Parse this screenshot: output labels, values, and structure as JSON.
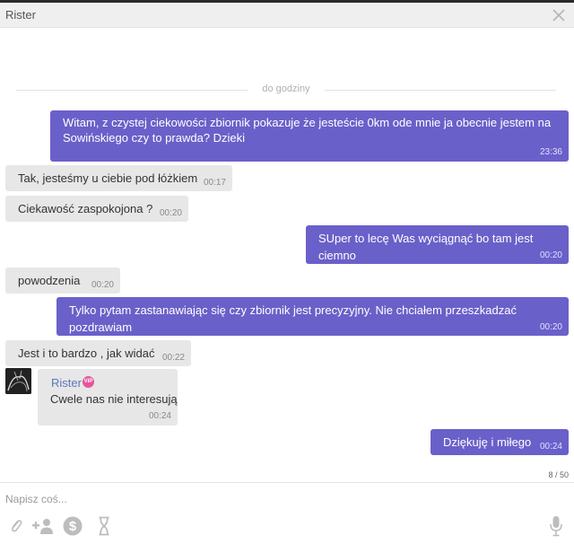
{
  "window": {
    "title": "Rister"
  },
  "divider": {
    "label": "do godziny"
  },
  "messages": [
    {
      "direction": "out",
      "text_lines": [
        "Witam, z czystej ciekowości zbiornik pokazuje że jesteście 0km ode mnie ja obecnie jestem na",
        "Sowińskiego czy to prawda? Dzieki"
      ],
      "time": "23:36"
    },
    {
      "direction": "in",
      "text": "Tak, jesteśmy u ciebie pod łóżkiem",
      "time": "00:17"
    },
    {
      "direction": "in",
      "text": "Ciekawość zaspokojona ?",
      "time": "00:20"
    },
    {
      "direction": "out",
      "text": "SUper to lecę Was wyciągnąć bo tam jest ciemno",
      "time": "00:20"
    },
    {
      "direction": "in",
      "text": "powodzenia",
      "time": "00:20"
    },
    {
      "direction": "out",
      "text": "Tylko pytam zastanawiając się czy zbiornik jest precyzyjny. Nie chciałem przeszkadzać pozdrawiam",
      "time": "00:20"
    },
    {
      "direction": "in",
      "text": "Jest i to bardzo , jak widać",
      "time": "00:22"
    },
    {
      "direction": "in",
      "sender": "Rister",
      "badge": "VIP",
      "text": "Cwele nas nie interesują",
      "time": "00:24"
    },
    {
      "direction": "out",
      "text": "Dziękuję i miłego",
      "time": "00:24"
    }
  ],
  "composer": {
    "placeholder": "Napisz coś...",
    "counter": "8 / 50"
  },
  "icons": {
    "close": "close-icon",
    "attach": "paperclip-icon",
    "add_user": "add-user-icon",
    "money": "dollar-icon",
    "timer": "hourglass-icon",
    "mic": "microphone-icon"
  },
  "colors": {
    "outgoing_bubble": "#6a60c9",
    "incoming_bubble": "#e7e7e7",
    "vip_badge": "#e4579c",
    "sender_name": "#5a78b8"
  }
}
